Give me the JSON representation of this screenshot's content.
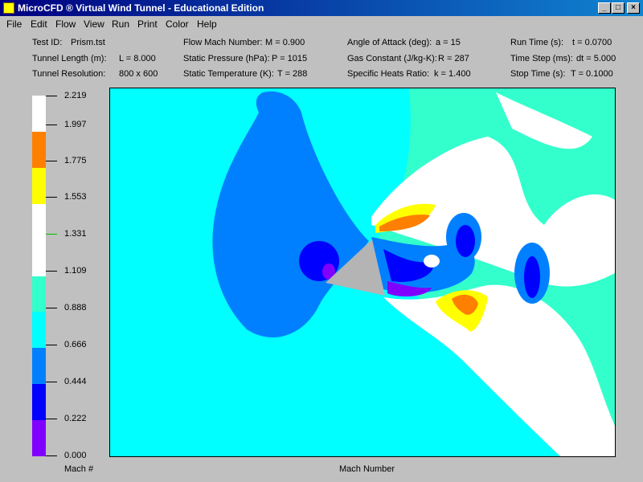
{
  "window": {
    "title": "MicroCFD ® Virtual Wind Tunnel - Educational Edition",
    "min_label": "_",
    "max_label": "□",
    "close_label": "×"
  },
  "menu": [
    "File",
    "Edit",
    "Flow",
    "View",
    "Run",
    "Print",
    "Color",
    "Help"
  ],
  "info": {
    "test_id": {
      "label": "Test ID:",
      "value": "Prism.tst"
    },
    "tunnel_length": {
      "label": "Tunnel Length (m):",
      "value": "L = 8.000"
    },
    "tunnel_resolution": {
      "label": "Tunnel Resolution:",
      "value": "800 x 600"
    },
    "mach": {
      "label": "Flow Mach Number:",
      "value": "M = 0.900"
    },
    "static_pressure": {
      "label": "Static Pressure (hPa):",
      "value": "P = 1015"
    },
    "static_temperature": {
      "label": "Static Temperature (K):",
      "value": "T = 288"
    },
    "angle_of_attack": {
      "label": "Angle of Attack (deg):",
      "value": "a = 15"
    },
    "gas_constant": {
      "label": "Gas Constant (J/kg-K):",
      "value": "R = 287"
    },
    "specific_heats": {
      "label": "Specific Heats Ratio:",
      "value": "k = 1.400"
    },
    "run_time": {
      "label": "Run Time (s):",
      "value": "t = 0.0700"
    },
    "time_step": {
      "label": "Time Step (ms):",
      "value": "dt = 5.000"
    },
    "stop_time": {
      "label": "Stop Time (s):",
      "value": "T = 0.1000"
    }
  },
  "legend": {
    "title": "Mach #",
    "labels": [
      "2.219",
      "1.997",
      "1.775",
      "1.553",
      "1.331",
      "1.109",
      "0.888",
      "0.666",
      "0.444",
      "0.222",
      "0.000"
    ],
    "band_colors": [
      "#ffffff",
      "#ff8000",
      "#ffff00",
      "#ffffff",
      "#ffffff",
      "#33ffcc",
      "#00ffff",
      "#0080ff",
      "#0000ff",
      "#8000ff"
    ]
  },
  "plot": {
    "caption": "Mach Number",
    "colors": {
      "bg": "#00ffff",
      "green": "#33ffcc",
      "white": "#ffffff",
      "mid_blue": "#0080ff",
      "blue": "#0000ff",
      "purple": "#8000ff",
      "yellow": "#ffff00",
      "orange": "#ff8000",
      "prism": "#b4b4b4"
    }
  }
}
